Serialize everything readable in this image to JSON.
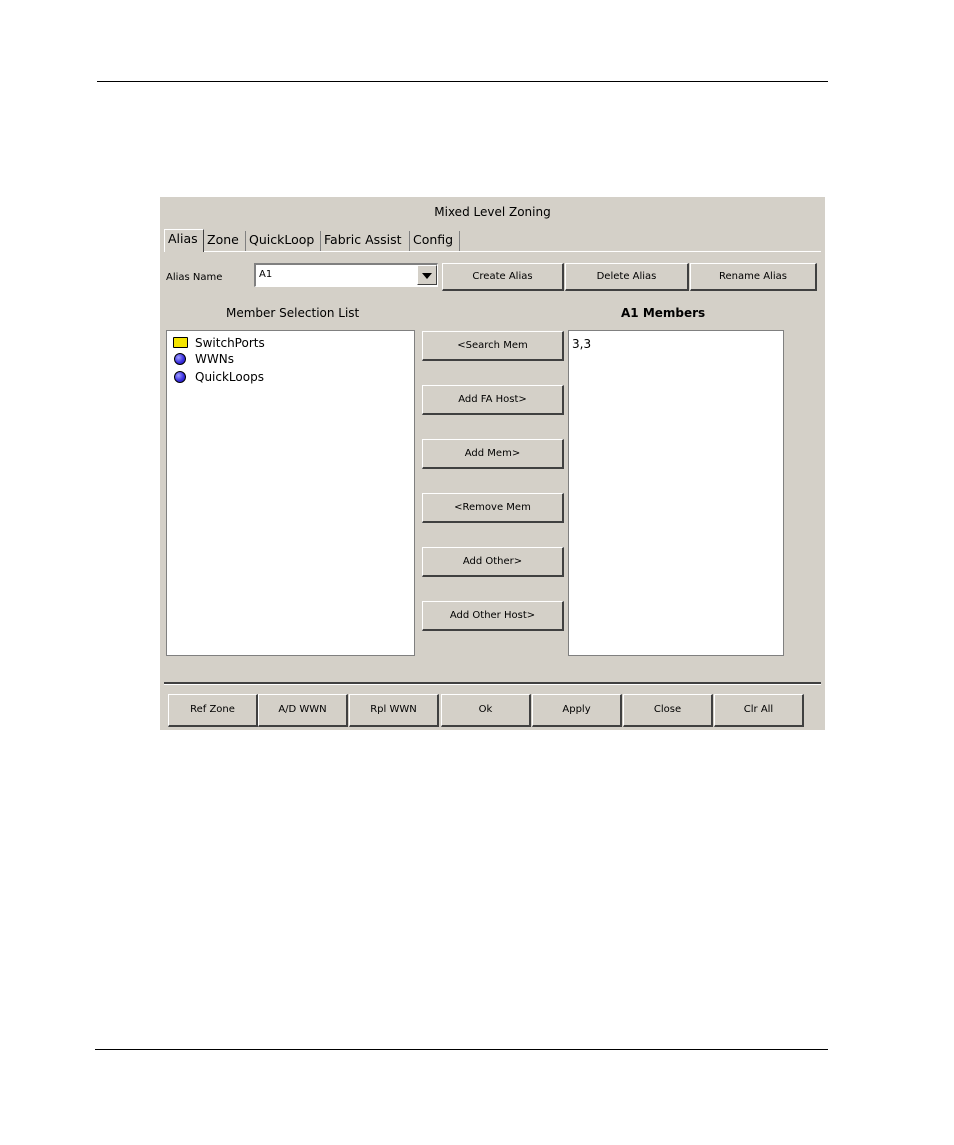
{
  "dialog": {
    "title": "Mixed Level Zoning"
  },
  "tabs": [
    {
      "label": "Alias",
      "active": true
    },
    {
      "label": "Zone",
      "active": false
    },
    {
      "label": "QuickLoop",
      "active": false
    },
    {
      "label": "Fabric Assist",
      "active": false
    },
    {
      "label": "Config",
      "active": false
    }
  ],
  "alias": {
    "name_label": "Alias Name",
    "name_value": "A1",
    "create_label": "Create Alias",
    "delete_label": "Delete Alias",
    "rename_label": "Rename Alias"
  },
  "member_selection": {
    "title": "Member Selection List",
    "items": [
      {
        "label": "SwitchPorts",
        "icon": "folder-icon"
      },
      {
        "label": "WWNs",
        "icon": "node-icon"
      },
      {
        "label": "QuickLoops",
        "icon": "node-icon"
      }
    ]
  },
  "actions": {
    "search_mem": "<Search Mem",
    "add_fa_host": "Add FA Host>",
    "add_mem": "Add Mem>",
    "remove_mem": "<Remove Mem",
    "add_other": "Add Other>",
    "add_other_host": "Add Other Host>"
  },
  "members": {
    "title": "A1 Members",
    "items": [
      "3,3"
    ]
  },
  "footer": {
    "ref_zone": "Ref Zone",
    "ad_wwn": "A/D WWN",
    "rpl_wwn": "Rpl WWN",
    "ok": "Ok",
    "apply": "Apply",
    "close": "Close",
    "clr_all": "Clr All"
  },
  "colors": {
    "dialog_bg": "#d4d0c8",
    "folder": "#f4e400",
    "node": "#3b30e0"
  }
}
